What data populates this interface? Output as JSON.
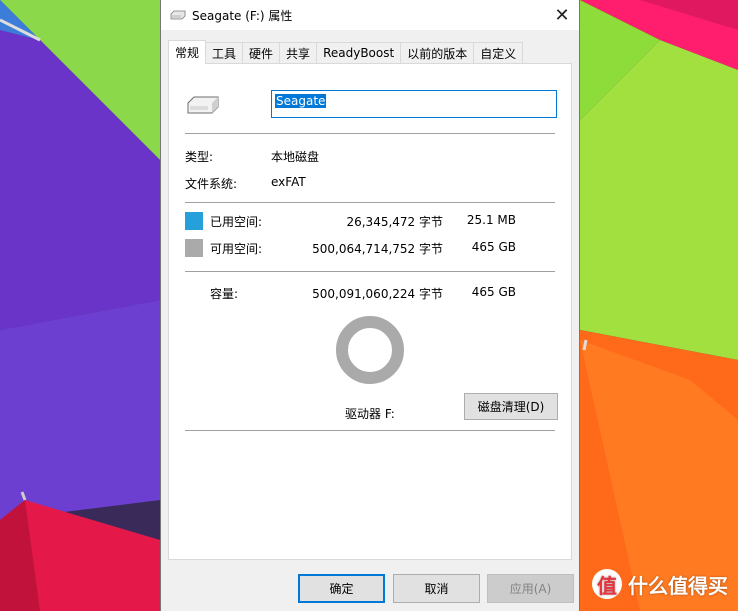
{
  "window": {
    "title": "Seagate (F:) 属性",
    "close_glyph": "✕"
  },
  "tabs": [
    {
      "label": "常规",
      "active": true
    },
    {
      "label": "工具"
    },
    {
      "label": "硬件"
    },
    {
      "label": "共享"
    },
    {
      "label": "ReadyBoost"
    },
    {
      "label": "以前的版本"
    },
    {
      "label": "自定义"
    }
  ],
  "general": {
    "volume_name": "Seagate",
    "type_label": "类型:",
    "type_value": "本地磁盘",
    "fs_label": "文件系统:",
    "fs_value": "exFAT",
    "used_label": "已用空间:",
    "used_bytes": "26,345,472 字节",
    "used_size": "25.1 MB",
    "free_label": "可用空间:",
    "free_bytes": "500,064,714,752 字节",
    "free_size": "465 GB",
    "capacity_label": "容量:",
    "capacity_bytes": "500,091,060,224 字节",
    "capacity_size": "465 GB",
    "drive_label": "驱动器 F:",
    "cleanup_button": "磁盘清理(D)",
    "used_fraction": 5.27e-05
  },
  "buttons": {
    "ok": "确定",
    "cancel": "取消",
    "apply": "应用(A)"
  },
  "colors": {
    "used": "#26a0da",
    "free": "#aaaaaa",
    "accent": "#0078d7"
  },
  "watermark": {
    "badge": "值",
    "text": "什么值得买"
  }
}
